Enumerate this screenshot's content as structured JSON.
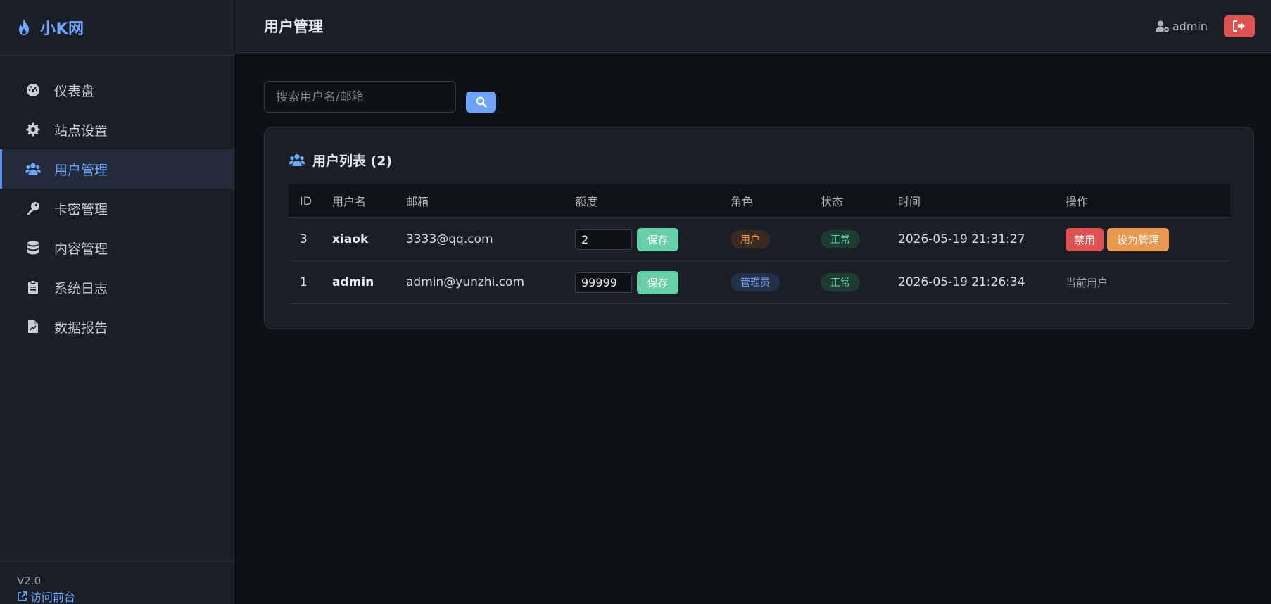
{
  "brand": {
    "name": "小K网",
    "icon": "flame-icon",
    "accent": "#6fa8ff"
  },
  "sidebar": {
    "items": [
      {
        "label": "仪表盘",
        "icon": "dashboard-icon",
        "active": false
      },
      {
        "label": "站点设置",
        "icon": "gear-icon",
        "active": false
      },
      {
        "label": "用户管理",
        "icon": "users-icon",
        "active": true
      },
      {
        "label": "卡密管理",
        "icon": "key-icon",
        "active": false
      },
      {
        "label": "内容管理",
        "icon": "database-icon",
        "active": false
      },
      {
        "label": "系统日志",
        "icon": "clipboard-icon",
        "active": false
      },
      {
        "label": "数据报告",
        "icon": "report-icon",
        "active": false
      }
    ],
    "version": "V2.0",
    "visit_label": "访问前台"
  },
  "header": {
    "title": "用户管理",
    "username": "admin",
    "logout_icon": "sign-out-icon"
  },
  "search": {
    "placeholder": "搜索用户名/邮箱",
    "value": ""
  },
  "user_list": {
    "title": "用户列表 (2)",
    "columns": [
      "ID",
      "用户名",
      "邮箱",
      "额度",
      "角色",
      "状态",
      "时间",
      "操作"
    ],
    "rows": [
      {
        "id": "3",
        "username": "xiaok",
        "email": "3333@qq.com",
        "quota": "2",
        "save_label": "保存",
        "role": "用户",
        "status": "正常",
        "time": "2026-05-19 21:31:27",
        "ban_label": "禁用",
        "promote_label": "设为管理"
      },
      {
        "id": "1",
        "username": "admin",
        "email": "admin@yunzhi.com",
        "quota": "99999",
        "save_label": "保存",
        "role": "管理员",
        "status": "正常",
        "time": "2026-05-19 21:26:34",
        "current_label": "当前用户"
      }
    ]
  },
  "colors": {
    "accent": "#6fa8ff",
    "danger": "#e05252",
    "success": "#67d0a6",
    "warning": "#ea9a4f"
  }
}
